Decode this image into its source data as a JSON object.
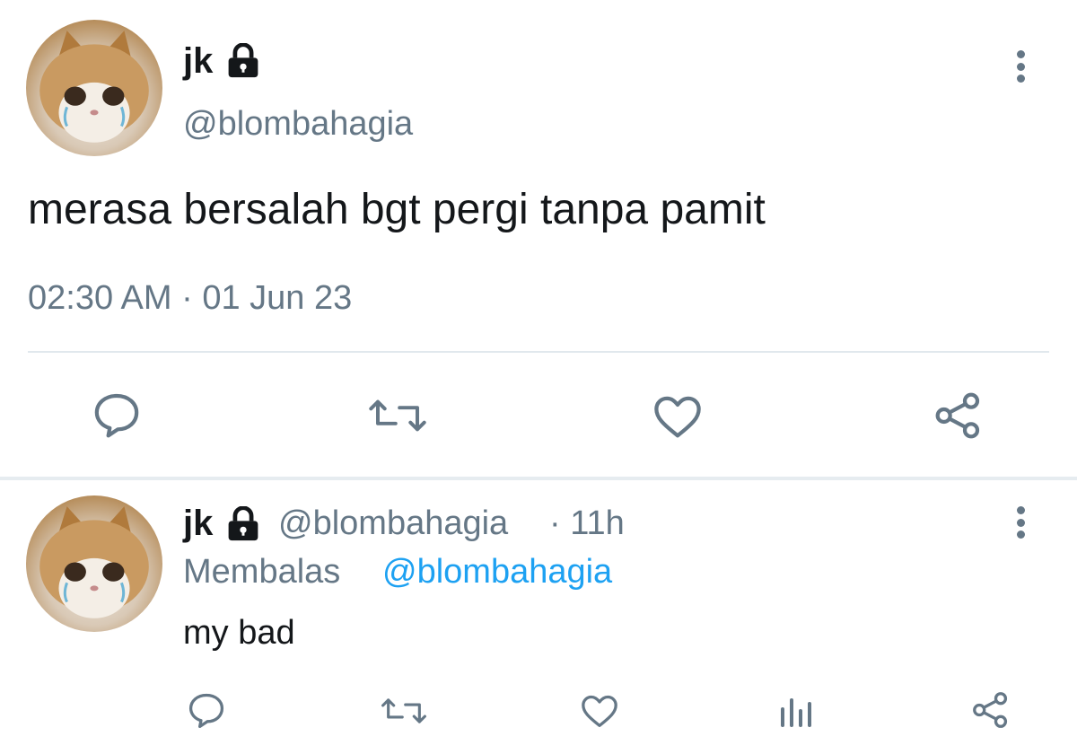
{
  "main_tweet": {
    "display_name": "jk",
    "handle": "@blombahagia",
    "text": "merasa bersalah bgt pergi tanpa pamit",
    "timestamp": "02:30 AM · 01 Jun 23",
    "actions": [
      "reply-icon",
      "retweet-icon",
      "like-icon",
      "share-icon"
    ]
  },
  "reply_tweet": {
    "display_name": "jk",
    "handle": "@blombahagia",
    "age": "· 11h",
    "replying_prefix": "Membalas",
    "replying_to": "@blombahagia",
    "text": "my bad",
    "actions": [
      "reply-icon",
      "retweet-icon",
      "like-icon",
      "analytics-icon",
      "share-icon"
    ]
  },
  "colors": {
    "text": "#14171a",
    "secondary": "#657786",
    "link": "#1da1f2",
    "divider": "#e1e8ed"
  }
}
